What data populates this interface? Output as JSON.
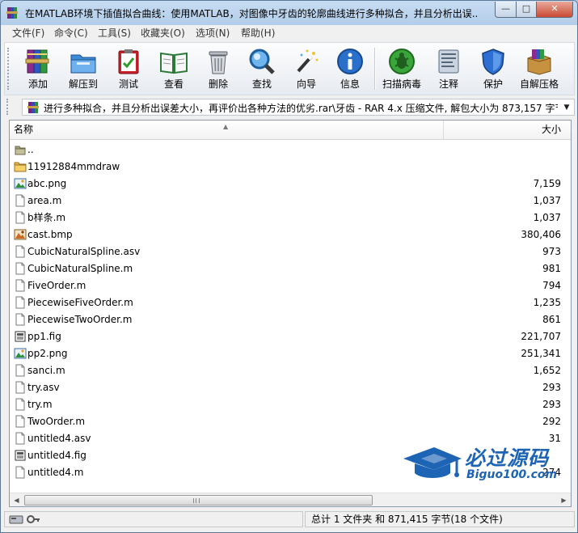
{
  "window": {
    "title": "在MATLAB环境下插值拟合曲线：使用MATLAB，对图像中牙齿的轮廓曲线进行多种拟合，并且分析出误..."
  },
  "menu": [
    "文件(F)",
    "命令(C)",
    "工具(S)",
    "收藏夹(O)",
    "选项(N)",
    "帮助(H)"
  ],
  "toolbar": {
    "items": [
      {
        "label": "添加",
        "icon": "books-icon"
      },
      {
        "label": "解压到",
        "icon": "folder-extract-icon"
      },
      {
        "label": "测试",
        "icon": "clipboard-check-icon"
      },
      {
        "label": "查看",
        "icon": "open-book-icon"
      },
      {
        "label": "删除",
        "icon": "trash-icon"
      },
      {
        "label": "查找",
        "icon": "magnifier-icon"
      },
      {
        "label": "向导",
        "icon": "magic-wand-icon"
      },
      {
        "label": "信息",
        "icon": "info-icon"
      },
      {
        "label": "扫描病毒",
        "icon": "virus-scan-icon"
      },
      {
        "label": "注释",
        "icon": "comment-icon"
      },
      {
        "label": "保护",
        "icon": "shield-icon"
      },
      {
        "label": "自解压格",
        "icon": "sfx-box-icon"
      }
    ]
  },
  "address": {
    "path": "进行多种拟合，并且分析出误差大小，再评价出各种方法的优劣.rar\\牙齿 - RAR 4.x 压缩文件, 解包大小为 873,157 字节"
  },
  "list": {
    "headers": {
      "name": "名称",
      "size": "大小"
    },
    "rows": [
      {
        "name": "..",
        "size": "",
        "icon": "parent-folder-icon"
      },
      {
        "name": "11912884mmdraw",
        "size": "",
        "icon": "folder-icon"
      },
      {
        "name": "abc.png",
        "size": "7,159",
        "icon": "image-file-icon"
      },
      {
        "name": "area.m",
        "size": "1,037",
        "icon": "file-icon"
      },
      {
        "name": "b样条.m",
        "size": "1,037",
        "icon": "file-icon"
      },
      {
        "name": "cast.bmp",
        "size": "380,406",
        "icon": "bitmap-file-icon"
      },
      {
        "name": "CubicNaturalSpline.asv",
        "size": "973",
        "icon": "file-icon"
      },
      {
        "name": "CubicNaturalSpline.m",
        "size": "981",
        "icon": "file-icon"
      },
      {
        "name": "FiveOrder.m",
        "size": "794",
        "icon": "file-icon"
      },
      {
        "name": "PiecewiseFiveOrder.m",
        "size": "1,235",
        "icon": "file-icon"
      },
      {
        "name": "PiecewiseTwoOrder.m",
        "size": "861",
        "icon": "file-icon"
      },
      {
        "name": "pp1.fig",
        "size": "221,707",
        "icon": "fig-file-icon"
      },
      {
        "name": "pp2.png",
        "size": "251,341",
        "icon": "image-file-icon"
      },
      {
        "name": "sanci.m",
        "size": "1,652",
        "icon": "file-icon"
      },
      {
        "name": "try.asv",
        "size": "293",
        "icon": "file-icon"
      },
      {
        "name": "try.m",
        "size": "293",
        "icon": "file-icon"
      },
      {
        "name": "TwoOrder.m",
        "size": "292",
        "icon": "file-icon"
      },
      {
        "name": "untitled4.asv",
        "size": "31",
        "icon": "file-icon"
      },
      {
        "name": "untitled4.fig",
        "size": "",
        "icon": "fig-file-icon"
      },
      {
        "name": "untitled4.m",
        "size": "274",
        "icon": "file-icon"
      }
    ]
  },
  "status": {
    "summary": "总计 1 文件夹 和 871,415 字节(18 个文件)"
  },
  "watermark": {
    "title": "必过源码",
    "url": "Biguo100.com"
  },
  "colors": {
    "title_bar": "#b9d1ea",
    "selection": "#cce8ff",
    "watermark": "#1e64b5"
  }
}
